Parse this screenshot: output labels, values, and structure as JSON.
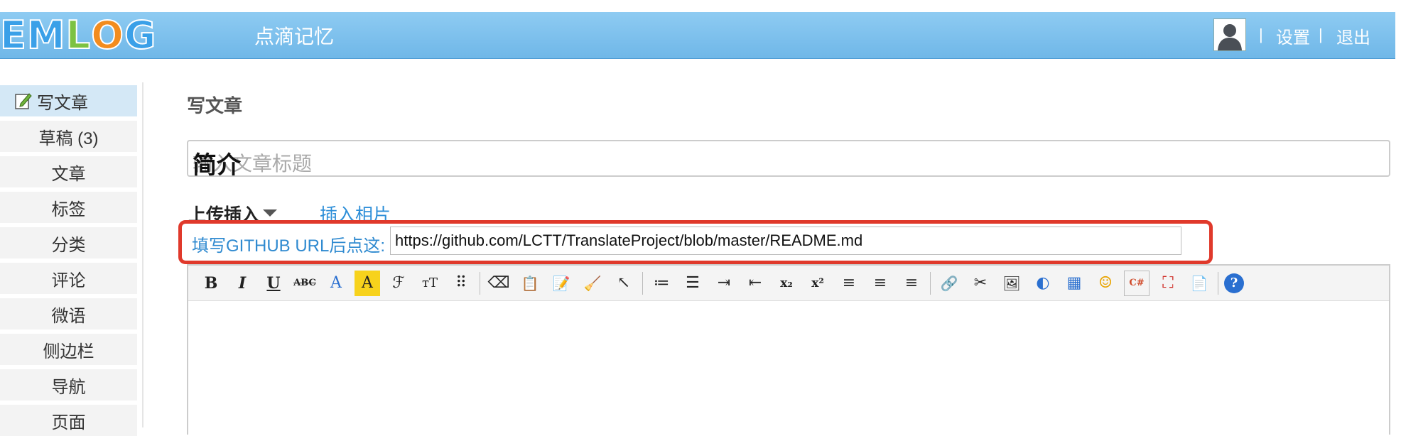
{
  "header": {
    "logo_letters": [
      "E",
      "M",
      "L",
      "O",
      "G"
    ],
    "logo_colors": [
      "#3aa0e8",
      "#3aa0e8",
      "#7cc242",
      "#f28c1e",
      "#3aa0e8"
    ],
    "site_title": "点滴记忆",
    "settings_label": "设置",
    "logout_label": "退出",
    "separator": "|"
  },
  "sidebar": {
    "items": [
      {
        "label": "写文章"
      },
      {
        "label": "草稿 (3)"
      },
      {
        "label": "文章"
      },
      {
        "label": "标签"
      },
      {
        "label": "分类"
      },
      {
        "label": "评论"
      },
      {
        "label": "微语"
      },
      {
        "label": "侧边栏"
      },
      {
        "label": "导航"
      },
      {
        "label": "页面"
      }
    ]
  },
  "main": {
    "page_title": "写文章",
    "title_value": "简介",
    "title_placeholder": "输入文章标题",
    "upload_label": "上传插入",
    "insert_photo_label": "插入相片",
    "github_label": "填写GITHUB URL后点这:",
    "github_url": "https://github.com/LCTT/TranslateProject/blob/master/README.md"
  },
  "toolbar": {
    "bold": "B",
    "italic": "I",
    "underline": "U",
    "strike": "ABC",
    "font_color": "A",
    "bg_color": "A",
    "font_family": "ℱ",
    "font_size": "тT",
    "line_height": "⠿",
    "eraser": "⌫",
    "paste_text": "📋",
    "paste_word": "📝",
    "clear": "🧹",
    "select": "↖",
    "ordered_list": "≔",
    "unordered_list": "☰",
    "indent": "⇥",
    "outdent": "⇤",
    "subscript": "x₂",
    "superscript": "x²",
    "align_left": "≡",
    "align_center": "≡",
    "align_right": "≡",
    "link": "🔗",
    "unlink": "✂",
    "image": "🖼",
    "flash": "◐",
    "table": "▦",
    "emoticon": "☺",
    "code": "C#",
    "fullscreen": "⛶",
    "template": "📄",
    "help": "?"
  },
  "colors": {
    "header_bar": "#79bdeb",
    "accent_blue": "#2f8ad0",
    "highlight_red": "#e0392b",
    "sidebar_active": "#d4e8f6"
  }
}
